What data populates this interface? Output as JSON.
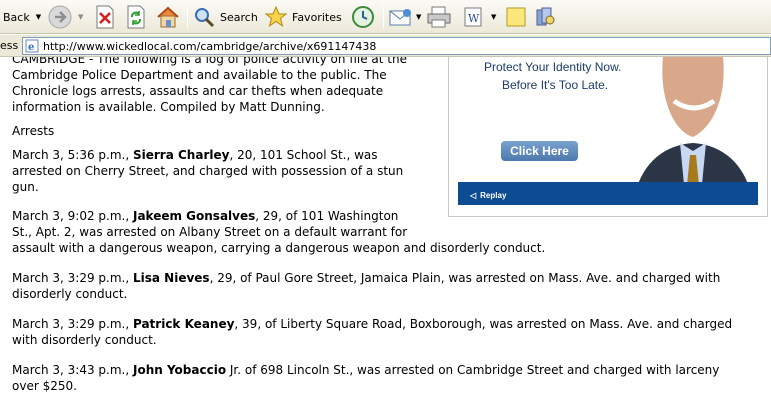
{
  "toolbar": {
    "back_label": "Back",
    "search_label": "Search",
    "favorites_label": "Favorites"
  },
  "address": {
    "label": "ess",
    "url": "http://www.wickedlocal.com/cambridge/archive/x691147438"
  },
  "article": {
    "intro_lines": [
      "CAMBRIDGE - The following is a log of police activity on file at the",
      "Cambridge Police Department and available to the public. The",
      "Chronicle logs arrests, assaults and car thefts when adequate",
      "information is available. Compiled by Matt Dunning."
    ],
    "section_heading": "Arrests",
    "entries": [
      {
        "prefix": "March 3, 5:36 p.m., ",
        "name": "Sierra Charley",
        "rest_line1": ", 20, 101 School St., was",
        "lines": [
          "arrested on Cherry Street, and charged with possession of a stun",
          "gun."
        ]
      },
      {
        "prefix": "March 3, 9:02 p.m., ",
        "name": "Jakeem Gonsalves",
        "rest_line1": ", 29, of 101 Washington",
        "lines": [
          "St., Apt. 2, was arrested on Albany Street on a default warrant for",
          "assault with a dangerous weapon, carrying a dangerous weapon and disorderly conduct."
        ]
      },
      {
        "prefix": "March 3, 3:29 p.m., ",
        "name": "Lisa Nieves",
        "rest_line1": ", 29, of Paul Gore Street, Jamaica Plain, was arrested on Mass. Ave. and charged with",
        "lines": [
          "disorderly conduct."
        ]
      },
      {
        "prefix": "March 3, 3:29 p.m., ",
        "name": "Patrick Keaney",
        "rest_line1": ", 39, of Liberty Square Road, Boxborough, was arrested on Mass. Ave. and charged",
        "lines": [
          "with disorderly conduct."
        ]
      },
      {
        "prefix": "March 3, 3:43 p.m., ",
        "name": "John Yobaccio",
        "rest_line1": " Jr. of 698 Lincoln St., was arrested on Cambridge Street and charged with larceny",
        "lines": [
          "over $250."
        ]
      }
    ]
  },
  "ad": {
    "line1": "Protect Your Identity Now.",
    "line2": "Before It's Too Late.",
    "button_label": "Click Here",
    "replay_label": "Replay",
    "colors": {
      "banner": "#0d4b93",
      "button": "#5a86bb"
    }
  }
}
